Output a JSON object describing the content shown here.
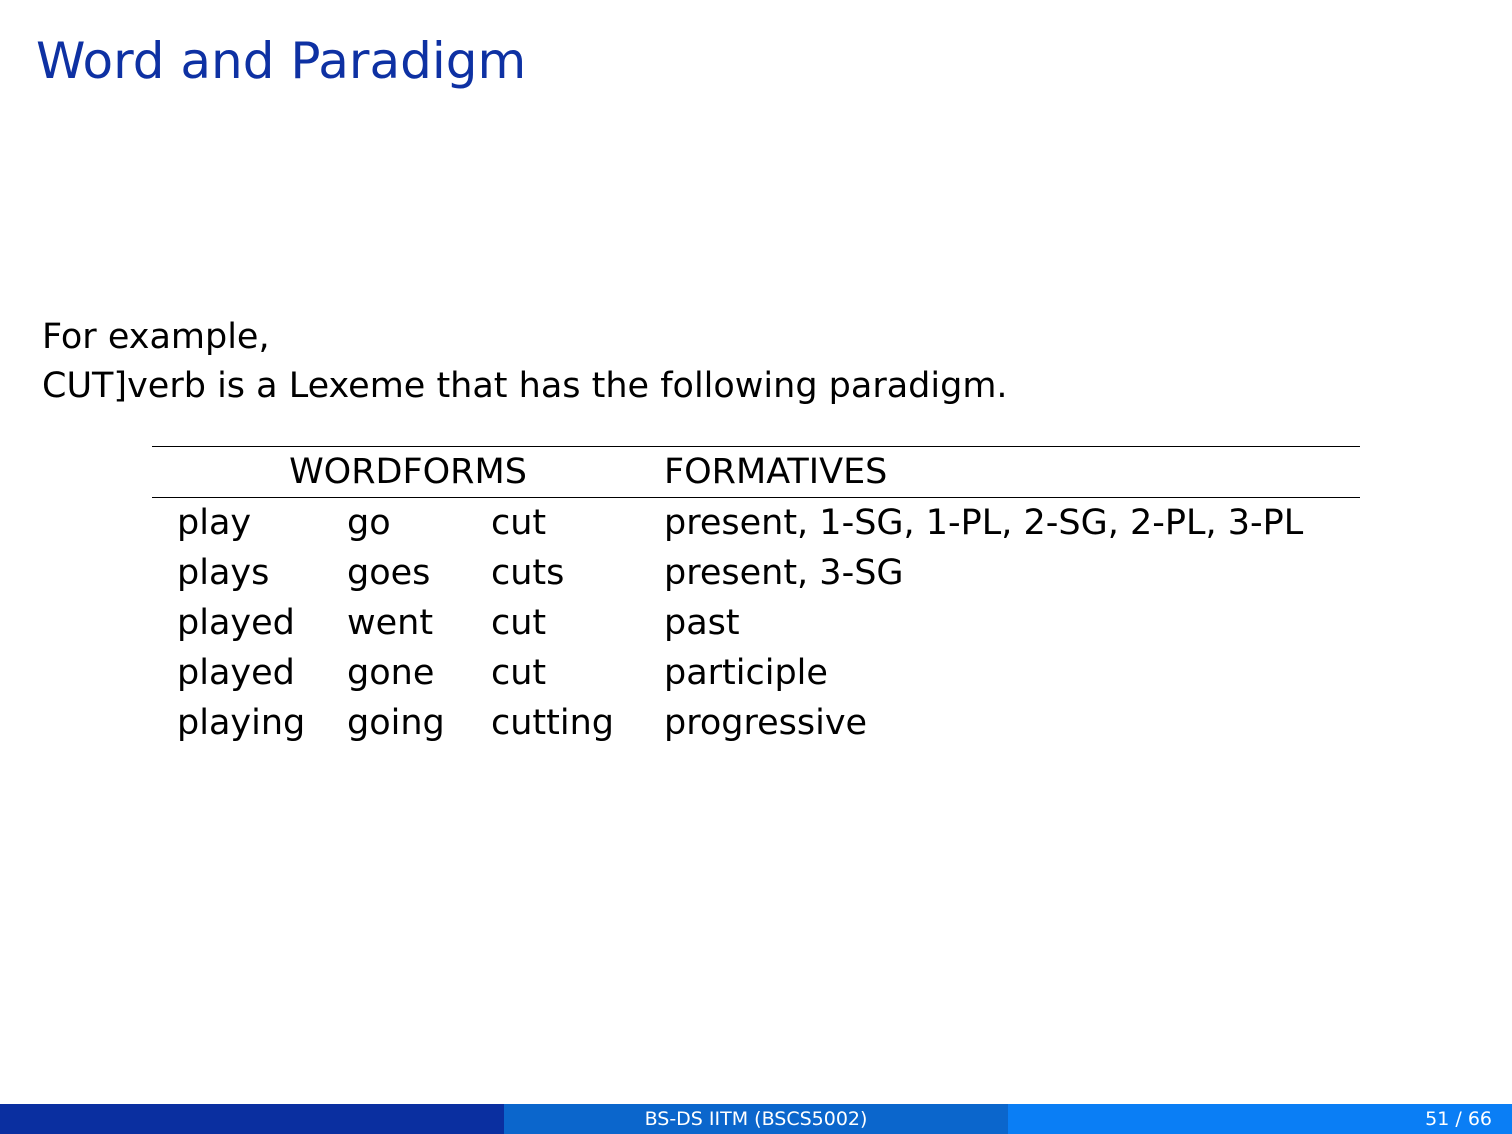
{
  "title": "Word and Paradigm",
  "intro": {
    "line1": "For example,",
    "line2": "CUT]verb is a Lexeme that has the following paradigm."
  },
  "table": {
    "headers": {
      "wordforms": "WORDFORMS",
      "formatives": "FORMATIVES"
    },
    "rows": [
      [
        "play",
        "go",
        "cut",
        "present, 1-SG, 1-PL, 2-SG, 2-PL, 3-PL"
      ],
      [
        "plays",
        "goes",
        "cuts",
        "present, 3-SG"
      ],
      [
        "played",
        "went",
        "cut",
        "past"
      ],
      [
        "played",
        "gone",
        "cut",
        "participle"
      ],
      [
        "playing",
        "going",
        "cutting",
        "progressive"
      ]
    ]
  },
  "footer": {
    "left": "",
    "center": "BS-DS IITM (BSCS5002)",
    "page": "51 / 66"
  },
  "colors": {
    "title": "#0e31a3",
    "footer_left": "#0a2fa0",
    "footer_mid": "#0b66cc",
    "footer_right": "#0a7ef5"
  }
}
